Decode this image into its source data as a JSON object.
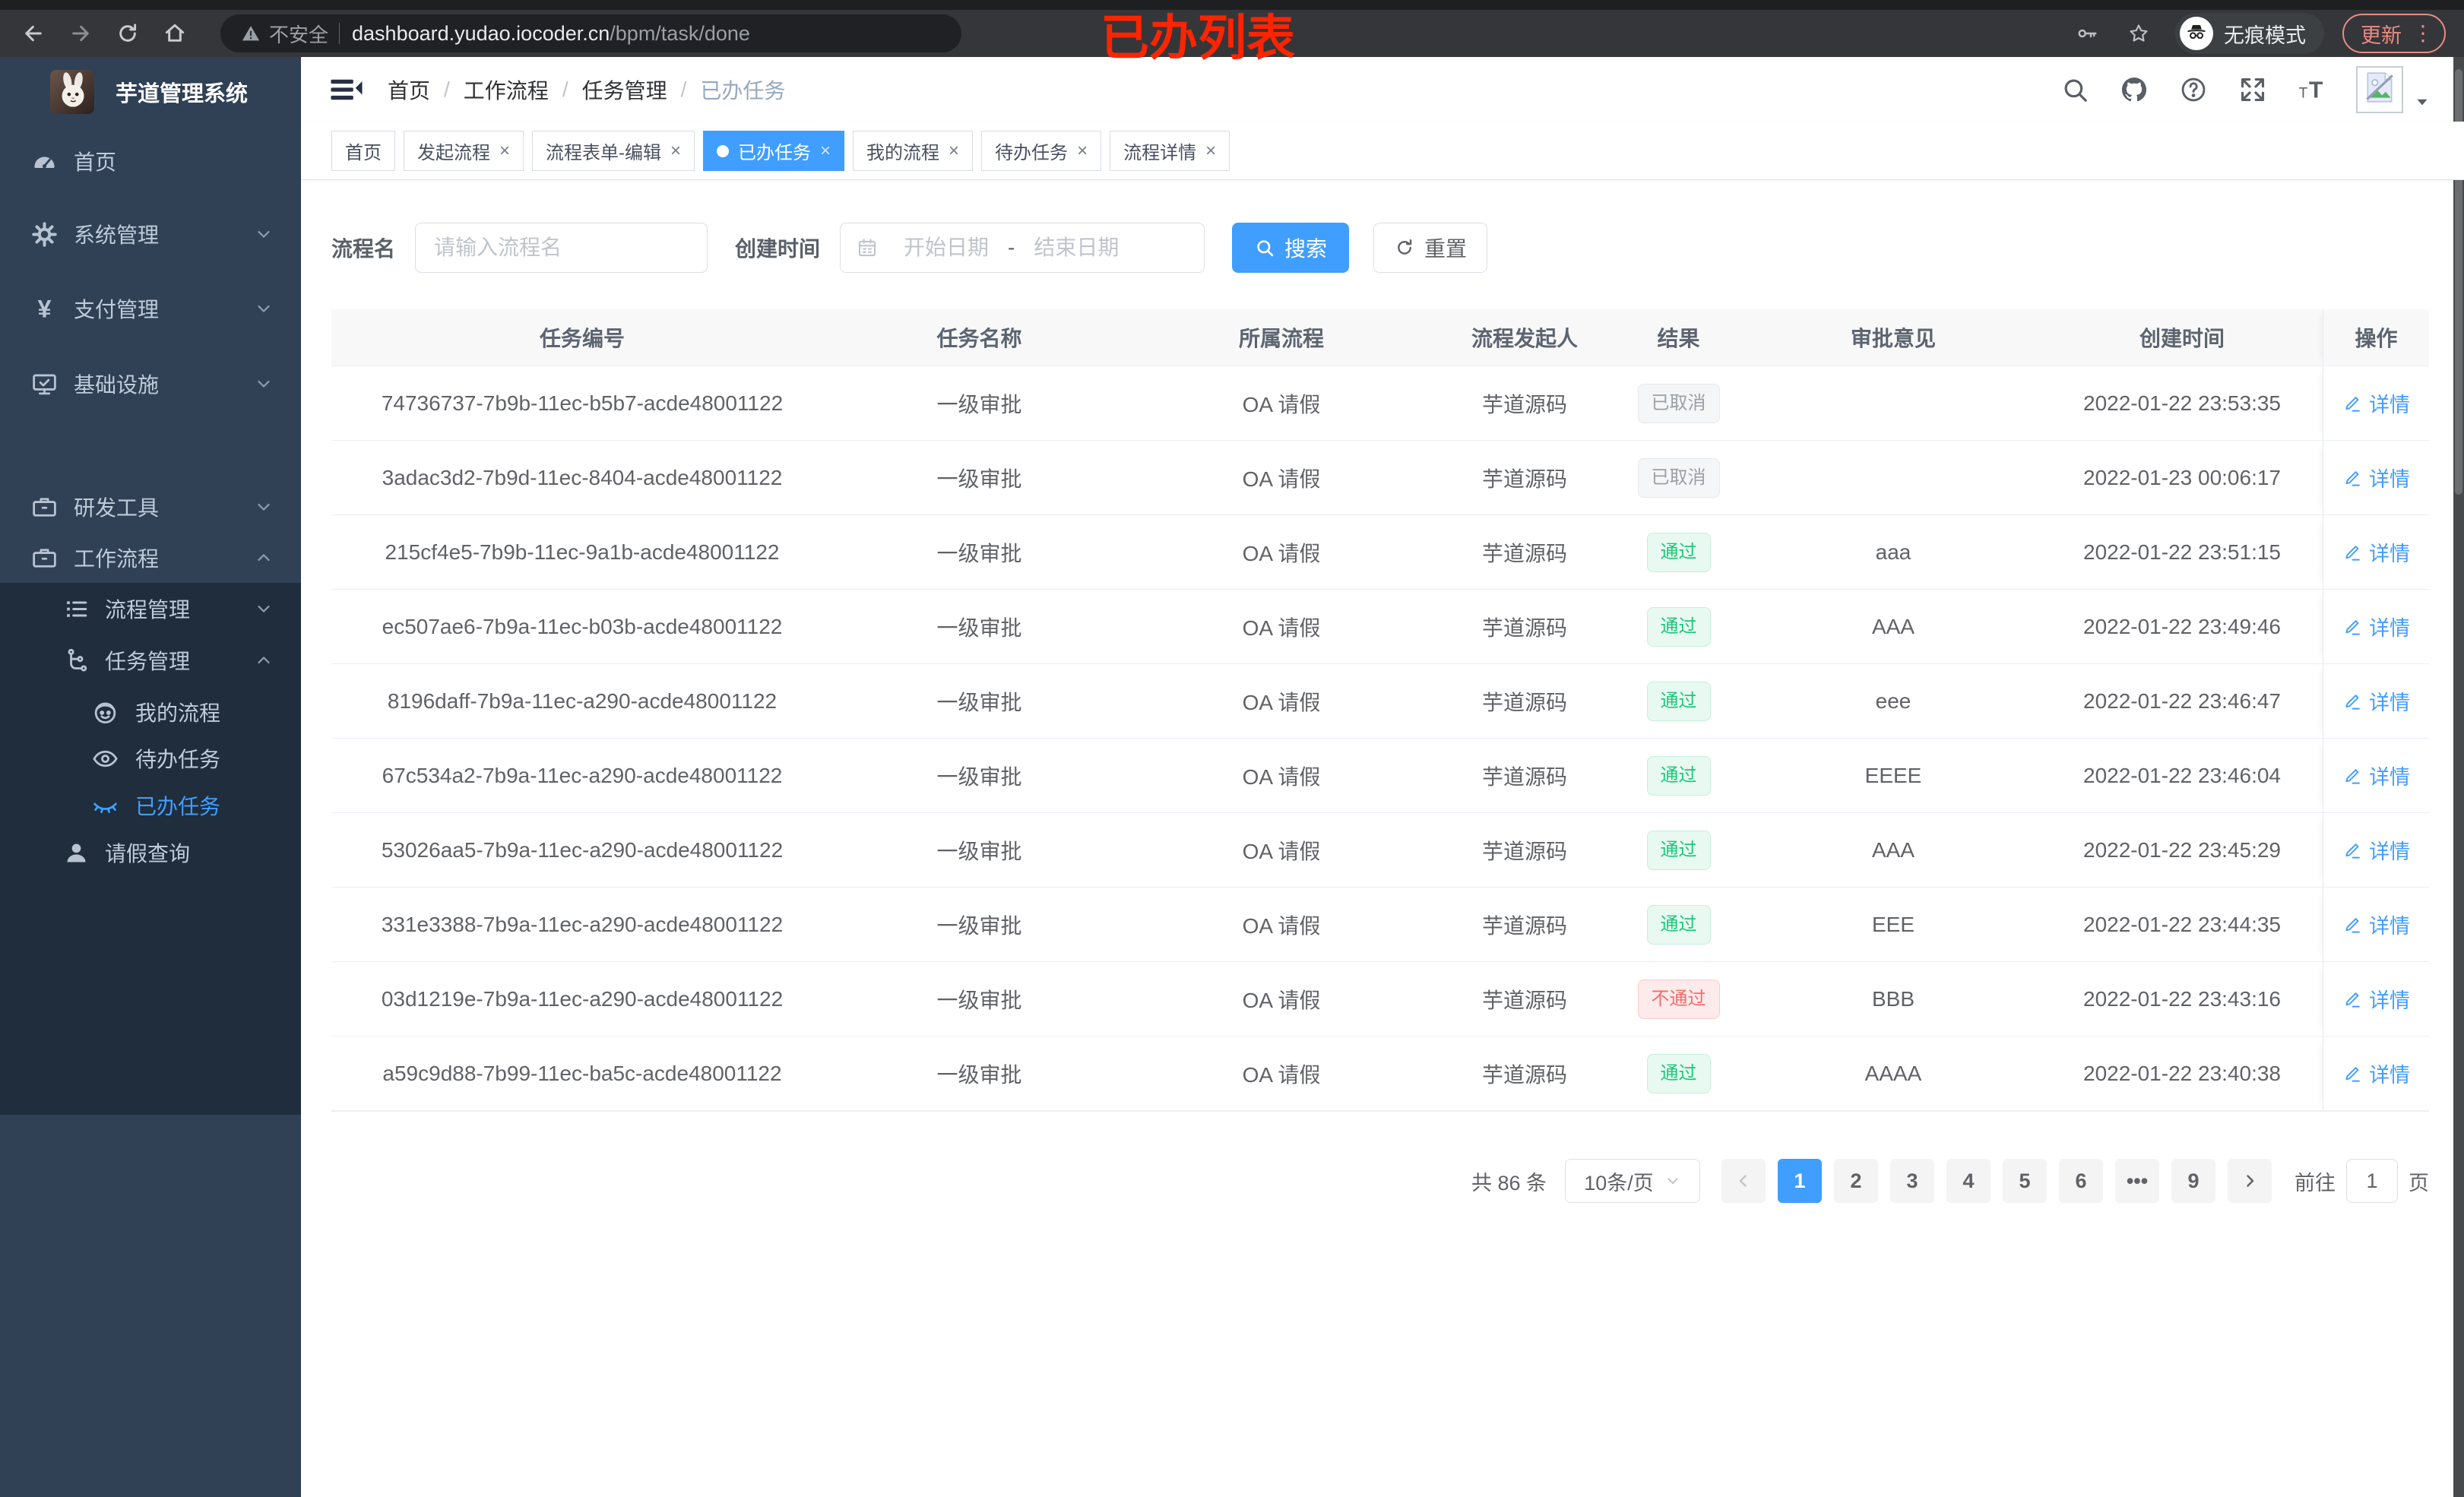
{
  "browser": {
    "security_label": "不安全",
    "url_domain": "dashboard.yudao.iocoder.cn",
    "url_path": "/bpm/task/done",
    "incognito_label": "无痕模式",
    "update_label": "更新",
    "menu_dots": "⋮"
  },
  "annotation": "已办列表",
  "colors": {
    "accent": "#409eff",
    "success": "#1dc779",
    "danger": "#f56c6c",
    "info": "#909399",
    "sidebar_bg": "#304156",
    "submenu_bg": "#1f2d3d"
  },
  "sidebar": {
    "title": "芋道管理系统",
    "items": [
      {
        "key": "home",
        "label": "首页",
        "icon": "dashboard",
        "level": 1
      },
      {
        "key": "system",
        "label": "系统管理",
        "icon": "gear",
        "level": 1,
        "chevron": "down"
      },
      {
        "key": "payment",
        "label": "支付管理",
        "icon": "yen",
        "level": 1,
        "chevron": "down"
      },
      {
        "key": "infra",
        "label": "基础设施",
        "icon": "monitor",
        "level": 1,
        "chevron": "down"
      },
      {
        "key": "devtools",
        "label": "研发工具",
        "icon": "toolbox",
        "level": 1,
        "chevron": "down"
      },
      {
        "key": "workflow",
        "label": "工作流程",
        "icon": "toolbox",
        "level": 1,
        "chevron": "up"
      },
      {
        "key": "process-mgmt",
        "label": "流程管理",
        "icon": "list",
        "level": 2,
        "chevron": "down"
      },
      {
        "key": "task-mgmt",
        "label": "任务管理",
        "icon": "branch",
        "level": 2,
        "chevron": "up"
      },
      {
        "key": "my-process",
        "label": "我的流程",
        "icon": "face",
        "level": 3
      },
      {
        "key": "todo-tasks",
        "label": "待办任务",
        "icon": "eye",
        "level": 3
      },
      {
        "key": "done-tasks",
        "label": "已办任务",
        "icon": "eye-closed",
        "level": 3,
        "active": true
      },
      {
        "key": "leave-query",
        "label": "请假查询",
        "icon": "user",
        "level": 2
      }
    ]
  },
  "breadcrumb": [
    "首页",
    "工作流程",
    "任务管理",
    "已办任务"
  ],
  "tabs": [
    {
      "key": "home",
      "label": "首页",
      "closable": false,
      "active": false
    },
    {
      "key": "launch-process",
      "label": "发起流程",
      "closable": true,
      "active": false
    },
    {
      "key": "form-edit",
      "label": "流程表单-编辑",
      "closable": true,
      "active": false
    },
    {
      "key": "done-tasks",
      "label": "已办任务",
      "closable": true,
      "active": true
    },
    {
      "key": "my-process",
      "label": "我的流程",
      "closable": true,
      "active": false
    },
    {
      "key": "todo-tasks",
      "label": "待办任务",
      "closable": true,
      "active": false
    },
    {
      "key": "process-detail",
      "label": "流程详情",
      "closable": true,
      "active": false
    }
  ],
  "filter": {
    "name_label": "流程名",
    "name_placeholder": "请输入流程名",
    "time_label": "创建时间",
    "start_placeholder": "开始日期",
    "range_separator": "-",
    "end_placeholder": "结束日期",
    "search_label": "搜索",
    "reset_label": "重置"
  },
  "table": {
    "columns": [
      "任务编号",
      "任务名称",
      "所属流程",
      "流程发起人",
      "结果",
      "审批意见",
      "创建时间",
      "操作"
    ],
    "action_label": "详情",
    "rows": [
      {
        "id": "74736737-7b9b-11ec-b5b7-acde48001122",
        "name": "一级审批",
        "process": "OA 请假",
        "starter": "芋道源码",
        "result": "已取消",
        "result_type": "info",
        "comment": "",
        "created": "2022-01-22 23:53:35"
      },
      {
        "id": "3adac3d2-7b9d-11ec-8404-acde48001122",
        "name": "一级审批",
        "process": "OA 请假",
        "starter": "芋道源码",
        "result": "已取消",
        "result_type": "info",
        "comment": "",
        "created": "2022-01-23 00:06:17"
      },
      {
        "id": "215cf4e5-7b9b-11ec-9a1b-acde48001122",
        "name": "一级审批",
        "process": "OA 请假",
        "starter": "芋道源码",
        "result": "通过",
        "result_type": "success",
        "comment": "aaa",
        "created": "2022-01-22 23:51:15"
      },
      {
        "id": "ec507ae6-7b9a-11ec-b03b-acde48001122",
        "name": "一级审批",
        "process": "OA 请假",
        "starter": "芋道源码",
        "result": "通过",
        "result_type": "success",
        "comment": "AAA",
        "created": "2022-01-22 23:49:46"
      },
      {
        "id": "8196daff-7b9a-11ec-a290-acde48001122",
        "name": "一级审批",
        "process": "OA 请假",
        "starter": "芋道源码",
        "result": "通过",
        "result_type": "success",
        "comment": "eee",
        "created": "2022-01-22 23:46:47"
      },
      {
        "id": "67c534a2-7b9a-11ec-a290-acde48001122",
        "name": "一级审批",
        "process": "OA 请假",
        "starter": "芋道源码",
        "result": "通过",
        "result_type": "success",
        "comment": "EEEE",
        "created": "2022-01-22 23:46:04"
      },
      {
        "id": "53026aa5-7b9a-11ec-a290-acde48001122",
        "name": "一级审批",
        "process": "OA 请假",
        "starter": "芋道源码",
        "result": "通过",
        "result_type": "success",
        "comment": "AAA",
        "created": "2022-01-22 23:45:29"
      },
      {
        "id": "331e3388-7b9a-11ec-a290-acde48001122",
        "name": "一级审批",
        "process": "OA 请假",
        "starter": "芋道源码",
        "result": "通过",
        "result_type": "success",
        "comment": "EEE",
        "created": "2022-01-22 23:44:35"
      },
      {
        "id": "03d1219e-7b9a-11ec-a290-acde48001122",
        "name": "一级审批",
        "process": "OA 请假",
        "starter": "芋道源码",
        "result": "不通过",
        "result_type": "danger",
        "comment": "BBB",
        "created": "2022-01-22 23:43:16"
      },
      {
        "id": "a59c9d88-7b99-11ec-ba5c-acde48001122",
        "name": "一级审批",
        "process": "OA 请假",
        "starter": "芋道源码",
        "result": "通过",
        "result_type": "success",
        "comment": "AAAA",
        "created": "2022-01-22 23:40:38"
      }
    ]
  },
  "pagination": {
    "total_label": "共 86 条",
    "page_size": "10条/页",
    "pages": [
      {
        "label": "1",
        "active": true
      },
      {
        "label": "2"
      },
      {
        "label": "3"
      },
      {
        "label": "4"
      },
      {
        "label": "5"
      },
      {
        "label": "6"
      },
      {
        "label": "•••",
        "ellipsis": true
      },
      {
        "label": "9"
      }
    ],
    "goto_label": "前往",
    "goto_value": "1",
    "page_suffix": "页"
  }
}
